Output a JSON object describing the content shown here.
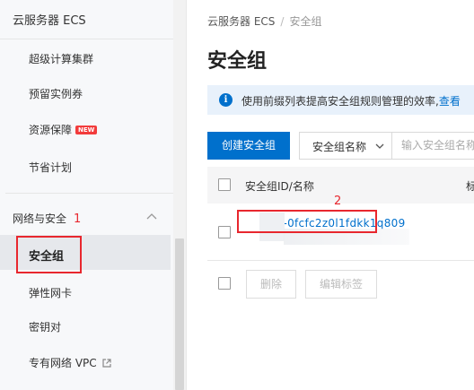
{
  "sidebar": {
    "title": "云服务器 ECS",
    "items": [
      {
        "label": "超级计算集群"
      },
      {
        "label": "预留实例券"
      },
      {
        "label": "资源保障",
        "badge": "NEW"
      },
      {
        "label": "节省计划"
      }
    ],
    "group": {
      "label": "网络与安全",
      "expanded": true
    },
    "group_items": [
      {
        "label": "安全组",
        "active": true
      },
      {
        "label": "弹性网卡"
      },
      {
        "label": "密钥对"
      },
      {
        "label": "专有网络 VPC",
        "external_icon": "external-link-icon"
      }
    ]
  },
  "annotations": [
    {
      "number": "1",
      "color": "#e8272e"
    },
    {
      "number": "2",
      "color": "#e8272e"
    }
  ],
  "breadcrumb": {
    "items": [
      "云服务器 ECS",
      "安全组"
    ],
    "separator": "/"
  },
  "page_title": "安全组",
  "tip": {
    "icon": "info-icon",
    "text": "使用前缀列表提高安全组规则管理的效率,",
    "link": "查看"
  },
  "toolbar": {
    "create_label": "创建安全组",
    "filter_select": {
      "value": "安全组名称",
      "icon": "chevron-down-icon"
    },
    "search_placeholder": "输入安全组名称"
  },
  "table": {
    "columns": [
      "安全组ID/名称",
      "标"
    ],
    "rows": [
      {
        "id_name": "sg-0fcfc2z0l1fdkk1q809",
        "tag_icon": "tag-icon"
      }
    ]
  },
  "bulk_actions": {
    "delete_label": "删除",
    "edit_tags_label": "编辑标签"
  },
  "colors": {
    "primary": "#0070cc",
    "annotation": "#e8272e",
    "badge_new": "#f23c3c",
    "tip_bg": "#e8f1fb"
  }
}
